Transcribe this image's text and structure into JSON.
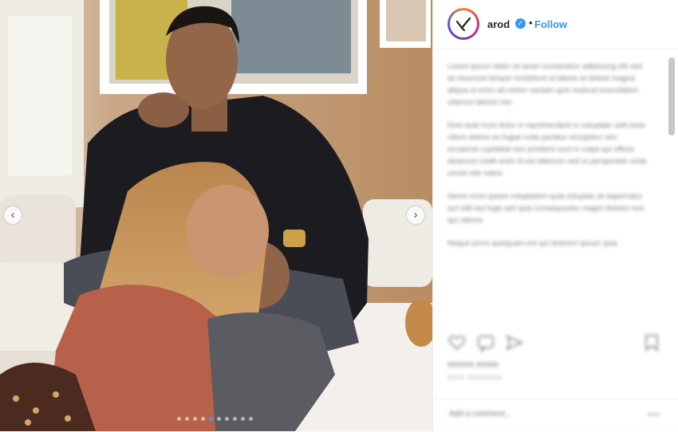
{
  "header": {
    "username": "arod",
    "separator": "•",
    "follow_label": "Follow",
    "verified_symbol": "✓"
  },
  "carousel": {
    "prev_symbol": "‹",
    "next_symbol": "›",
    "dot_count": 10,
    "active_dot": 4
  },
  "caption": {
    "paragraphs": [
      "Lorem ipsum dolor sit amet consectetur adipiscing elit sed do eiusmod tempor incididunt ut labore et dolore magna aliqua ut enim ad minim veniam quis nostrud exercitation ullamco laboris nisi",
      "Duis aute irure dolor in reprehenderit in voluptate velit esse cillum dolore eu fugiat nulla pariatur excepteur sint occaecat cupidatat non proident sunt in culpa qui officia deserunt mollit anim id est laborum sed ut perspiciatis unde omnis iste natus",
      "Nemo enim ipsam voluptatem quia voluptas sit aspernatur aut odit aut fugit sed quia consequuntur magni dolores eos qui ratione",
      "Neque porro quisquam est qui dolorem ipsum quia"
    ]
  },
  "actions": {
    "like_icon": "heart-icon",
    "comment_icon": "comment-icon",
    "share_icon": "share-icon",
    "save_icon": "bookmark-icon"
  },
  "stats": {
    "likes": "xxxxxx xxxxx",
    "timestamp": "xxxx xxxxxxxx"
  },
  "comment": {
    "placeholder": "Add a comment...",
    "more": "•••"
  }
}
